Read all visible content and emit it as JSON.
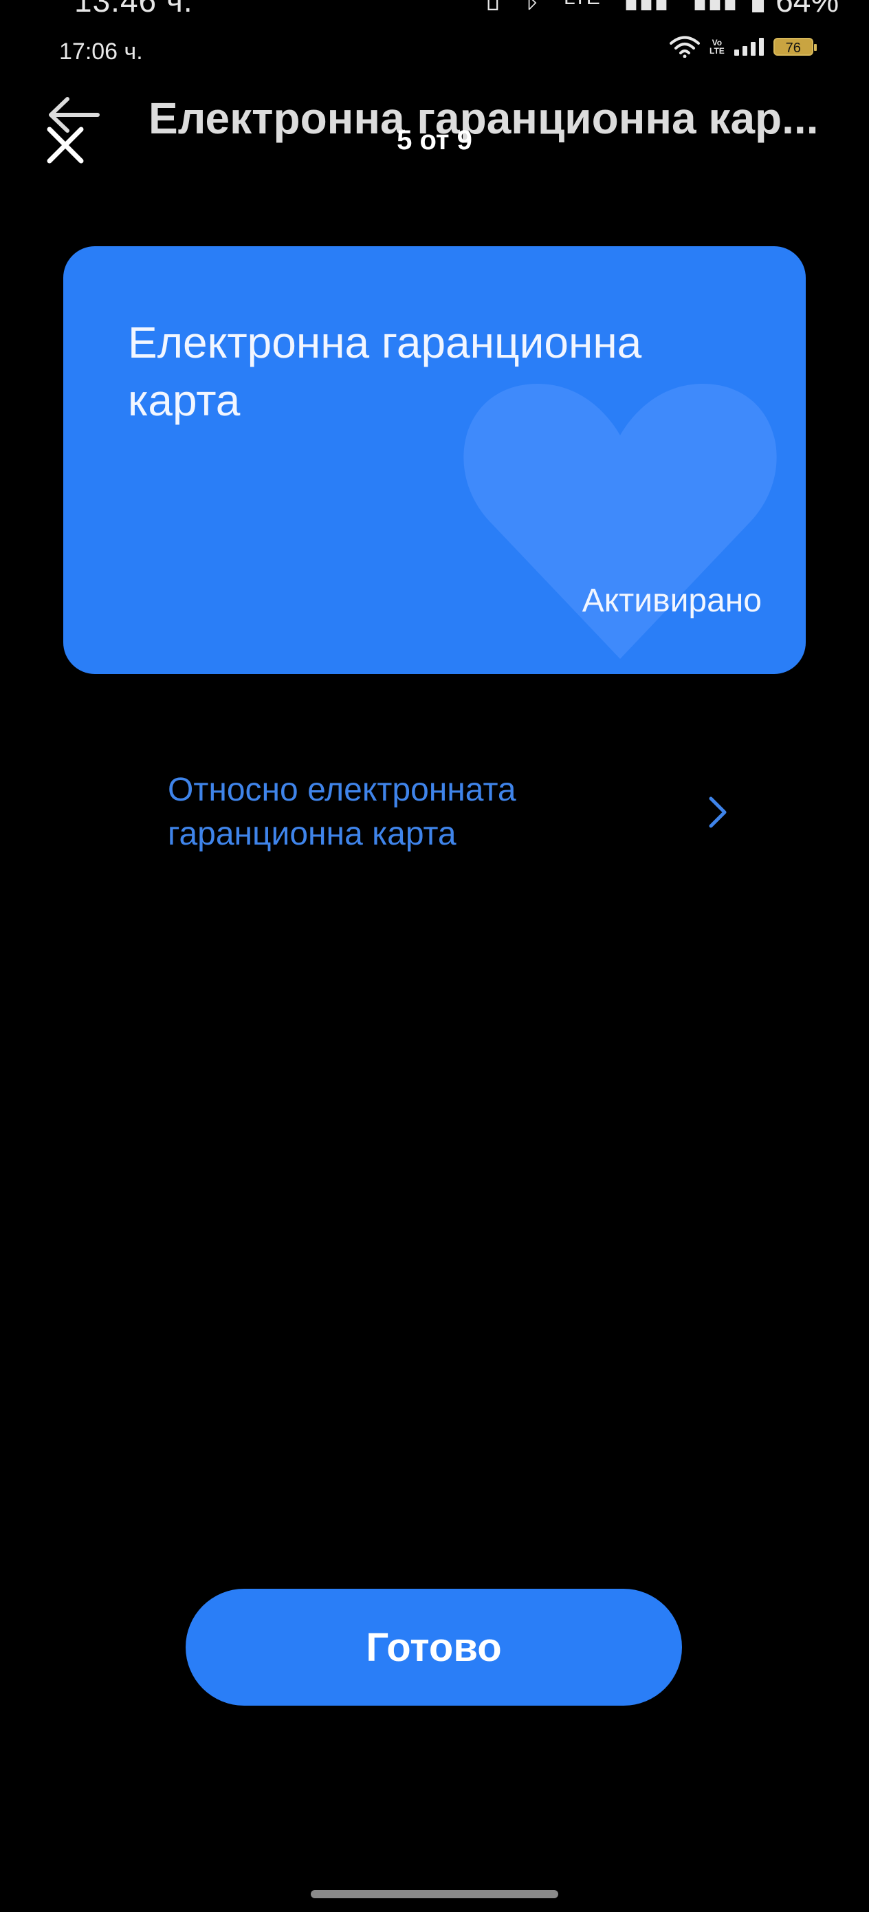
{
  "outer_status": {
    "time": "13:46 ч.",
    "battery": "64%",
    "network": "LTE"
  },
  "status": {
    "time": "17:06 ч.",
    "battery_level": "76",
    "volte_top": "Vo",
    "volte_bottom": "LTE"
  },
  "header": {
    "title": "Електронна гаранционна кар...",
    "page_counter": "5 от 9"
  },
  "card": {
    "title": "Електронна гаранционна карта",
    "status": "Активирано",
    "color": "#2a7ef7"
  },
  "about_link": {
    "label": "Относно електронната гаранционна карта",
    "color": "#3f84ea"
  },
  "done_button": {
    "label": "Готово"
  },
  "icons": {
    "back": "arrow-left",
    "close": "close-x",
    "chevron": "chevron-right",
    "wifi": "wifi",
    "signal": "signal-bars",
    "card_decoration": "heart"
  }
}
